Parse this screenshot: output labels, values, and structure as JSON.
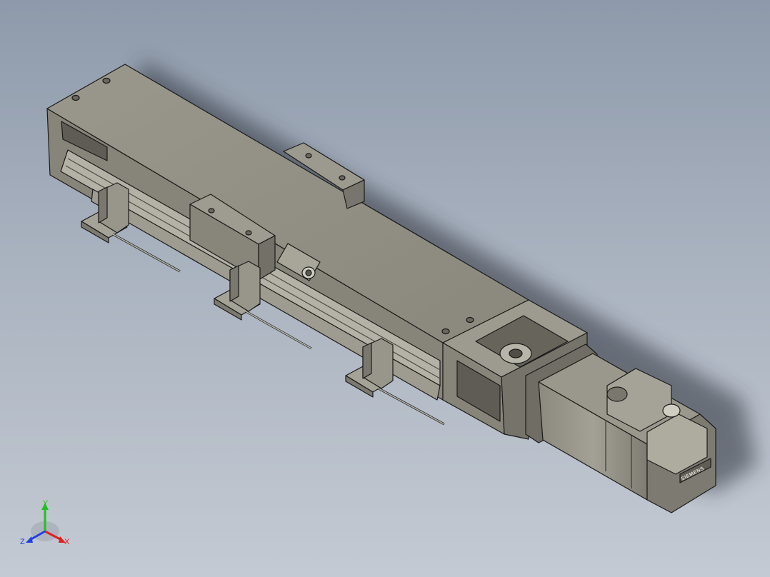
{
  "viewport": {
    "model": "linear-actuator-assembly",
    "background_top": "#8e9aab",
    "background_bottom": "#c4cad3",
    "part_color": "#8f8d82",
    "part_dark": "#6f6d64",
    "part_light": "#a8a699",
    "edge_color": "#1a1a1a"
  },
  "motor": {
    "brand_label": "SIEMENS"
  },
  "triad": {
    "x_label": "X",
    "y_label": "Y",
    "z_label": "Z",
    "x_color": "#e02020",
    "y_color": "#20c020",
    "z_color": "#2040e0"
  }
}
